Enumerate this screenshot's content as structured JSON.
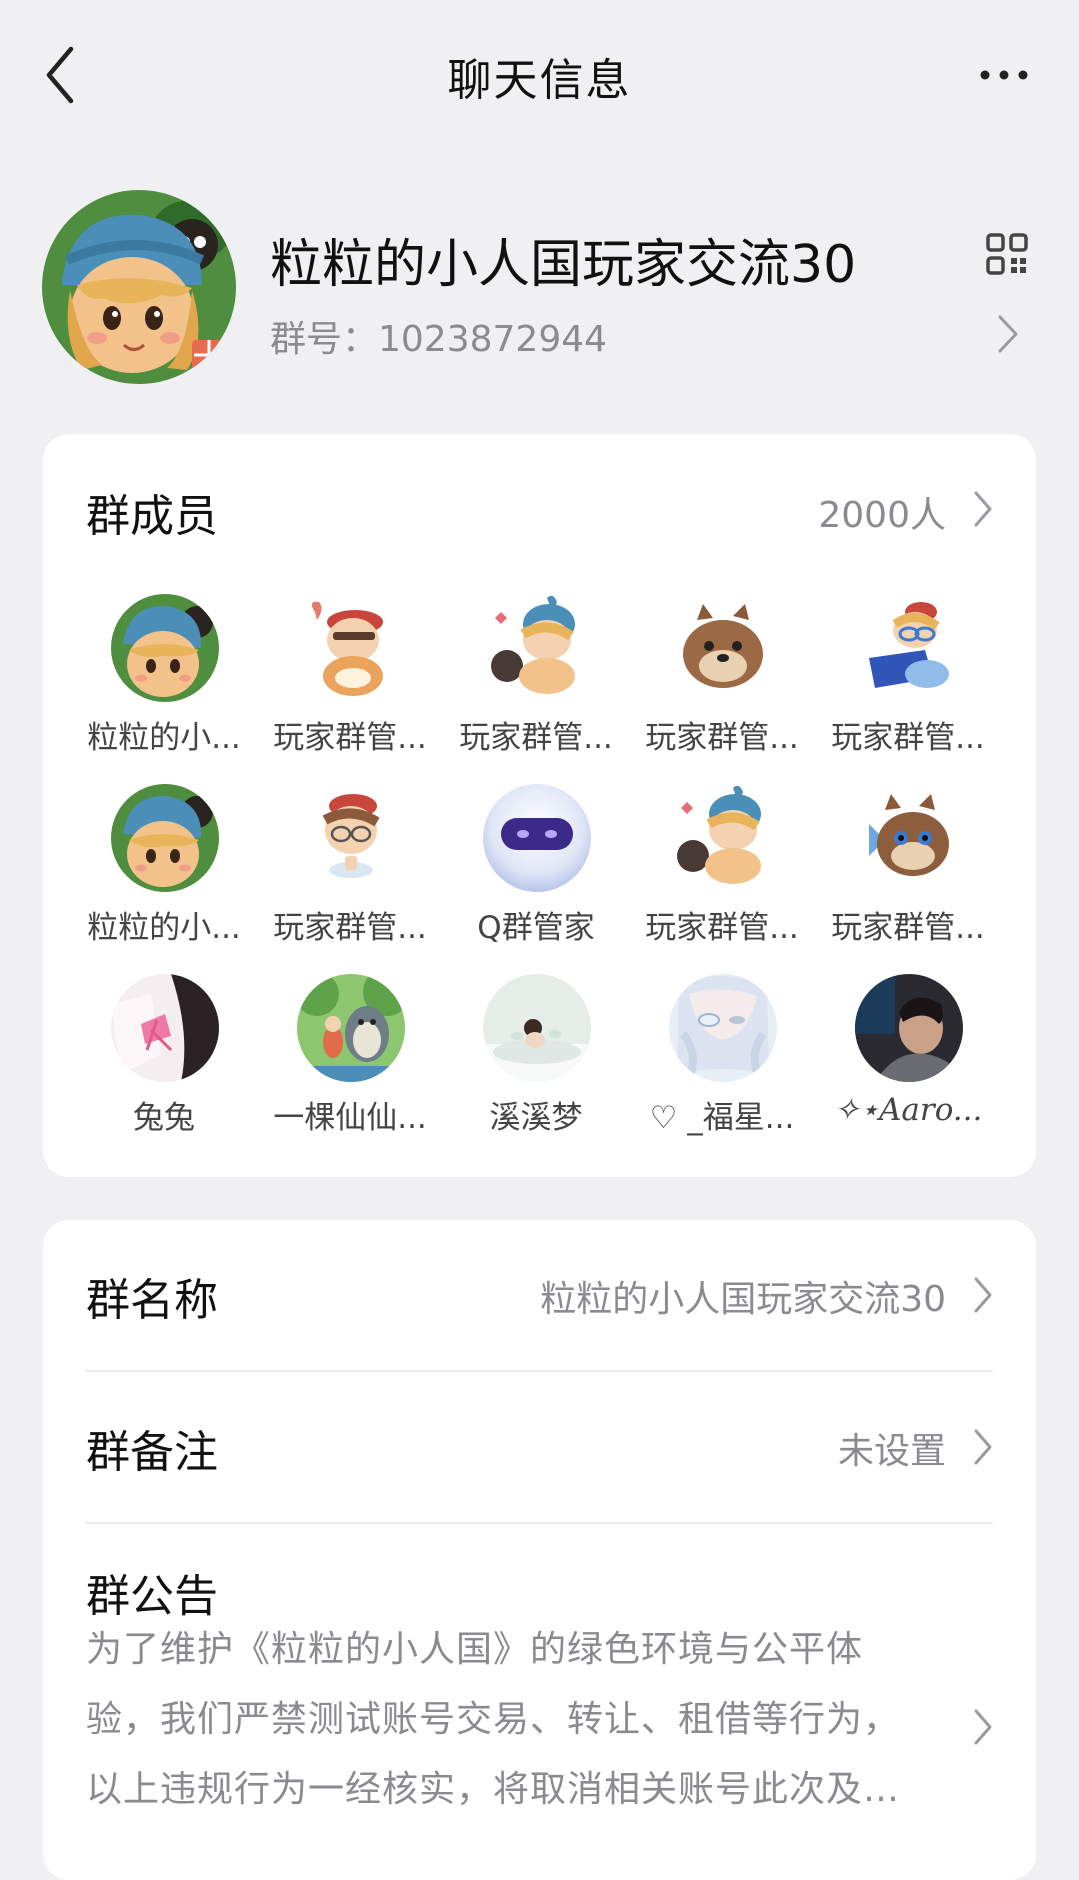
{
  "header": {
    "title": "聊天信息",
    "back_icon": "chevron-left-icon",
    "more_icon": "more-horizontal-icon"
  },
  "group": {
    "name": "粒粒的小人国玩家交流30",
    "id_label": "群号：1023872944",
    "qr_icon": "qr-code-icon"
  },
  "members": {
    "label": "群成员",
    "count": "2000人",
    "list": [
      {
        "name": "粒粒的小...",
        "avatar": "doll-girl"
      },
      {
        "name": "玩家群管...",
        "avatar": "chibi-red-hat"
      },
      {
        "name": "玩家群管...",
        "avatar": "chibi-blue-bunny"
      },
      {
        "name": "玩家群管...",
        "avatar": "brown-raccoon"
      },
      {
        "name": "玩家群管...",
        "avatar": "chibi-laptop"
      },
      {
        "name": "粒粒的小...",
        "avatar": "doll-girl"
      },
      {
        "name": "玩家群管...",
        "avatar": "chibi-glasses"
      },
      {
        "name": "Q群管家",
        "avatar": "robot-orb"
      },
      {
        "name": "玩家群管...",
        "avatar": "chibi-blue-bunny"
      },
      {
        "name": "玩家群管...",
        "avatar": "brown-raccoon"
      },
      {
        "name": "兔兔",
        "avatar": "pink-bow"
      },
      {
        "name": "一棵仙仙...",
        "avatar": "forest-totoro"
      },
      {
        "name": "溪溪梦",
        "avatar": "bath-photo"
      },
      {
        "name": "♡ _福星...",
        "avatar": "pale-anime"
      },
      {
        "name": "✧⋆Aaro...",
        "avatar": "man-portrait"
      }
    ]
  },
  "settings": {
    "group_name_label": "群名称",
    "group_name_value": "粒粒的小人国玩家交流30",
    "group_remark_label": "群备注",
    "group_remark_value": "未设置",
    "notice_label": "群公告",
    "notice_text": "为了维护《粒粒的小人国》的绿色环境与公平体验，我们严禁测试账号交易、转让、租借等行为，以上违规行为一经核实，将取消相关账号此次及后续的测试资格。"
  },
  "colors": {
    "background": "#f0f0f2",
    "card": "#ffffff",
    "secondary_text": "#8a8a8f"
  }
}
